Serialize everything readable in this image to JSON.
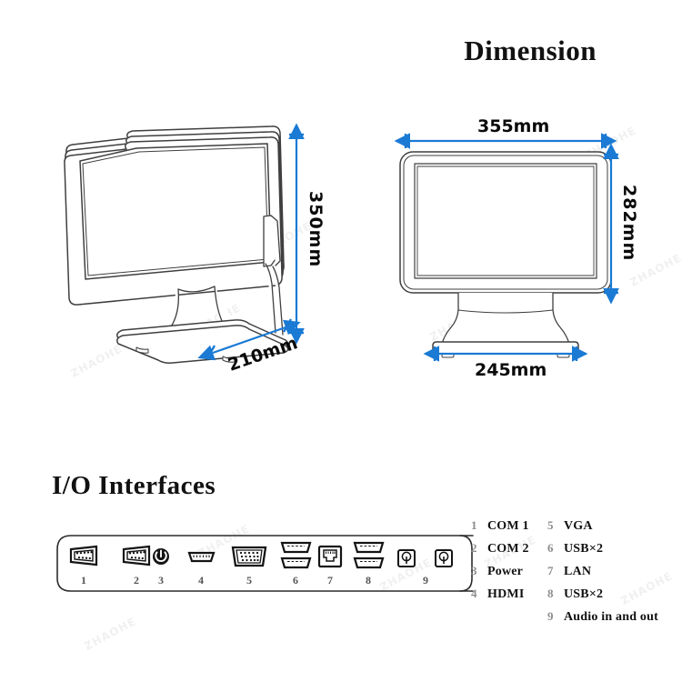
{
  "headings": {
    "dimension": "Dimension",
    "io": "I/O Interfaces"
  },
  "dimensions": {
    "side_view": {
      "height": "350mm",
      "depth": "210mm"
    },
    "front_view": {
      "width": "355mm",
      "height": "282mm",
      "base_width": "245mm"
    }
  },
  "io_legend": {
    "column_1": [
      {
        "num": "1",
        "label": "COM 1"
      },
      {
        "num": "2",
        "label": "COM 2"
      },
      {
        "num": "3",
        "label": "Power"
      },
      {
        "num": "4",
        "label": "HDMI"
      }
    ],
    "column_2": [
      {
        "num": "5",
        "label": "VGA"
      },
      {
        "num": "6",
        "label": "USB×2"
      },
      {
        "num": "7",
        "label": "LAN"
      },
      {
        "num": "8",
        "label": "USB×2"
      },
      {
        "num": "9",
        "label": "Audio in and out"
      }
    ]
  },
  "io_ports": [
    {
      "num": "1",
      "icon": "db9-serial-port-icon"
    },
    {
      "num": "2",
      "icon": "db9-serial-port-icon"
    },
    {
      "num": "3",
      "icon": "power-button-icon"
    },
    {
      "num": "4",
      "icon": "hdmi-port-icon"
    },
    {
      "num": "5",
      "icon": "vga-port-icon"
    },
    {
      "num": "6",
      "icon": "usb-dual-port-icon"
    },
    {
      "num": "7",
      "icon": "rj45-lan-port-icon"
    },
    {
      "num": "8",
      "icon": "usb-dual-port-icon"
    },
    {
      "num": "9",
      "icon": "audio-jack-icon"
    }
  ],
  "colors": {
    "dimension_arrow": "#1a7ad4",
    "outline": "#3a3a3a",
    "text": "#111111",
    "legend_number": "#8d8d8d",
    "background": "#ffffff"
  },
  "watermark": {
    "text": "ZHAOHE"
  }
}
